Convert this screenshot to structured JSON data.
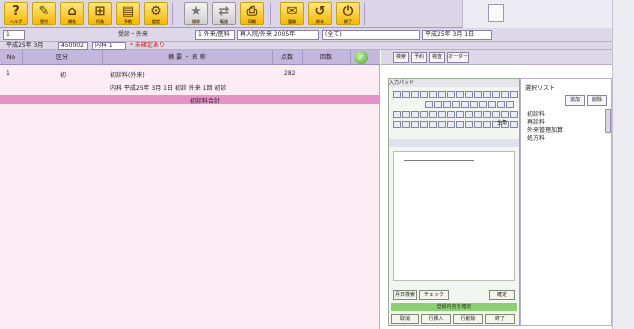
{
  "toolbar": {
    "buttons": [
      {
        "icon": "?",
        "caption": "ヘルプ"
      },
      {
        "icon": "✎",
        "caption": "受付"
      },
      {
        "icon": "⌂",
        "caption": "病名"
      },
      {
        "icon": "⊞",
        "caption": "行為"
      },
      {
        "icon": "▤",
        "caption": "予約"
      },
      {
        "icon": "⚙",
        "caption": "設定"
      },
      {
        "icon": "★",
        "caption": "保存"
      },
      {
        "icon": "⇄",
        "caption": "転送"
      },
      {
        "icon": "⎙",
        "caption": "印刷"
      },
      {
        "icon": "✉",
        "caption": "連絡"
      },
      {
        "icon": "↺",
        "caption": "戻る"
      },
      {
        "icon": "⏻",
        "caption": "終了"
      }
    ]
  },
  "info_row1": {
    "patient_id": "1",
    "name_label": "受診・外来",
    "fields": [
      "1 外来/医科",
      "再入院/外来 2005年",
      "(全て)"
    ],
    "date_field": "平成25年 3月 1日"
  },
  "info_row2": {
    "date": "平成25年 3月",
    "code": "450002",
    "dept": "内科 1",
    "status_red": "* 未確定あり"
  },
  "list_header": {
    "cols": [
      "No",
      "区分",
      "摘 要 ・ 名 称",
      "点数",
      "回数"
    ],
    "check_icon": "✓"
  },
  "list_rows": [
    {
      "no": "1",
      "kubun": "初",
      "name": "初診料(外来)",
      "points": "282",
      "sub": "内科 平成25年 3月 1日 初診 外来 1回 初診"
    }
  ],
  "pink_row_label": "初診料合計",
  "tabs": [
    "検索",
    "予約",
    "検査",
    "オーダー"
  ],
  "keypad": {
    "title": "入力パッド",
    "mode_label": "全角",
    "bottom_buttons": [
      "月日検索",
      "チェック",
      "確定"
    ],
    "green_bar_label": "登録内容を確定",
    "last_buttons": [
      "取消",
      "行挿入",
      "行削除",
      "終了"
    ]
  },
  "far_right": {
    "title": "選択リスト",
    "buttons": [
      "追加",
      "削除"
    ],
    "lines": [
      "初診料",
      "再診料",
      "外来管理加算",
      "処方料"
    ]
  }
}
